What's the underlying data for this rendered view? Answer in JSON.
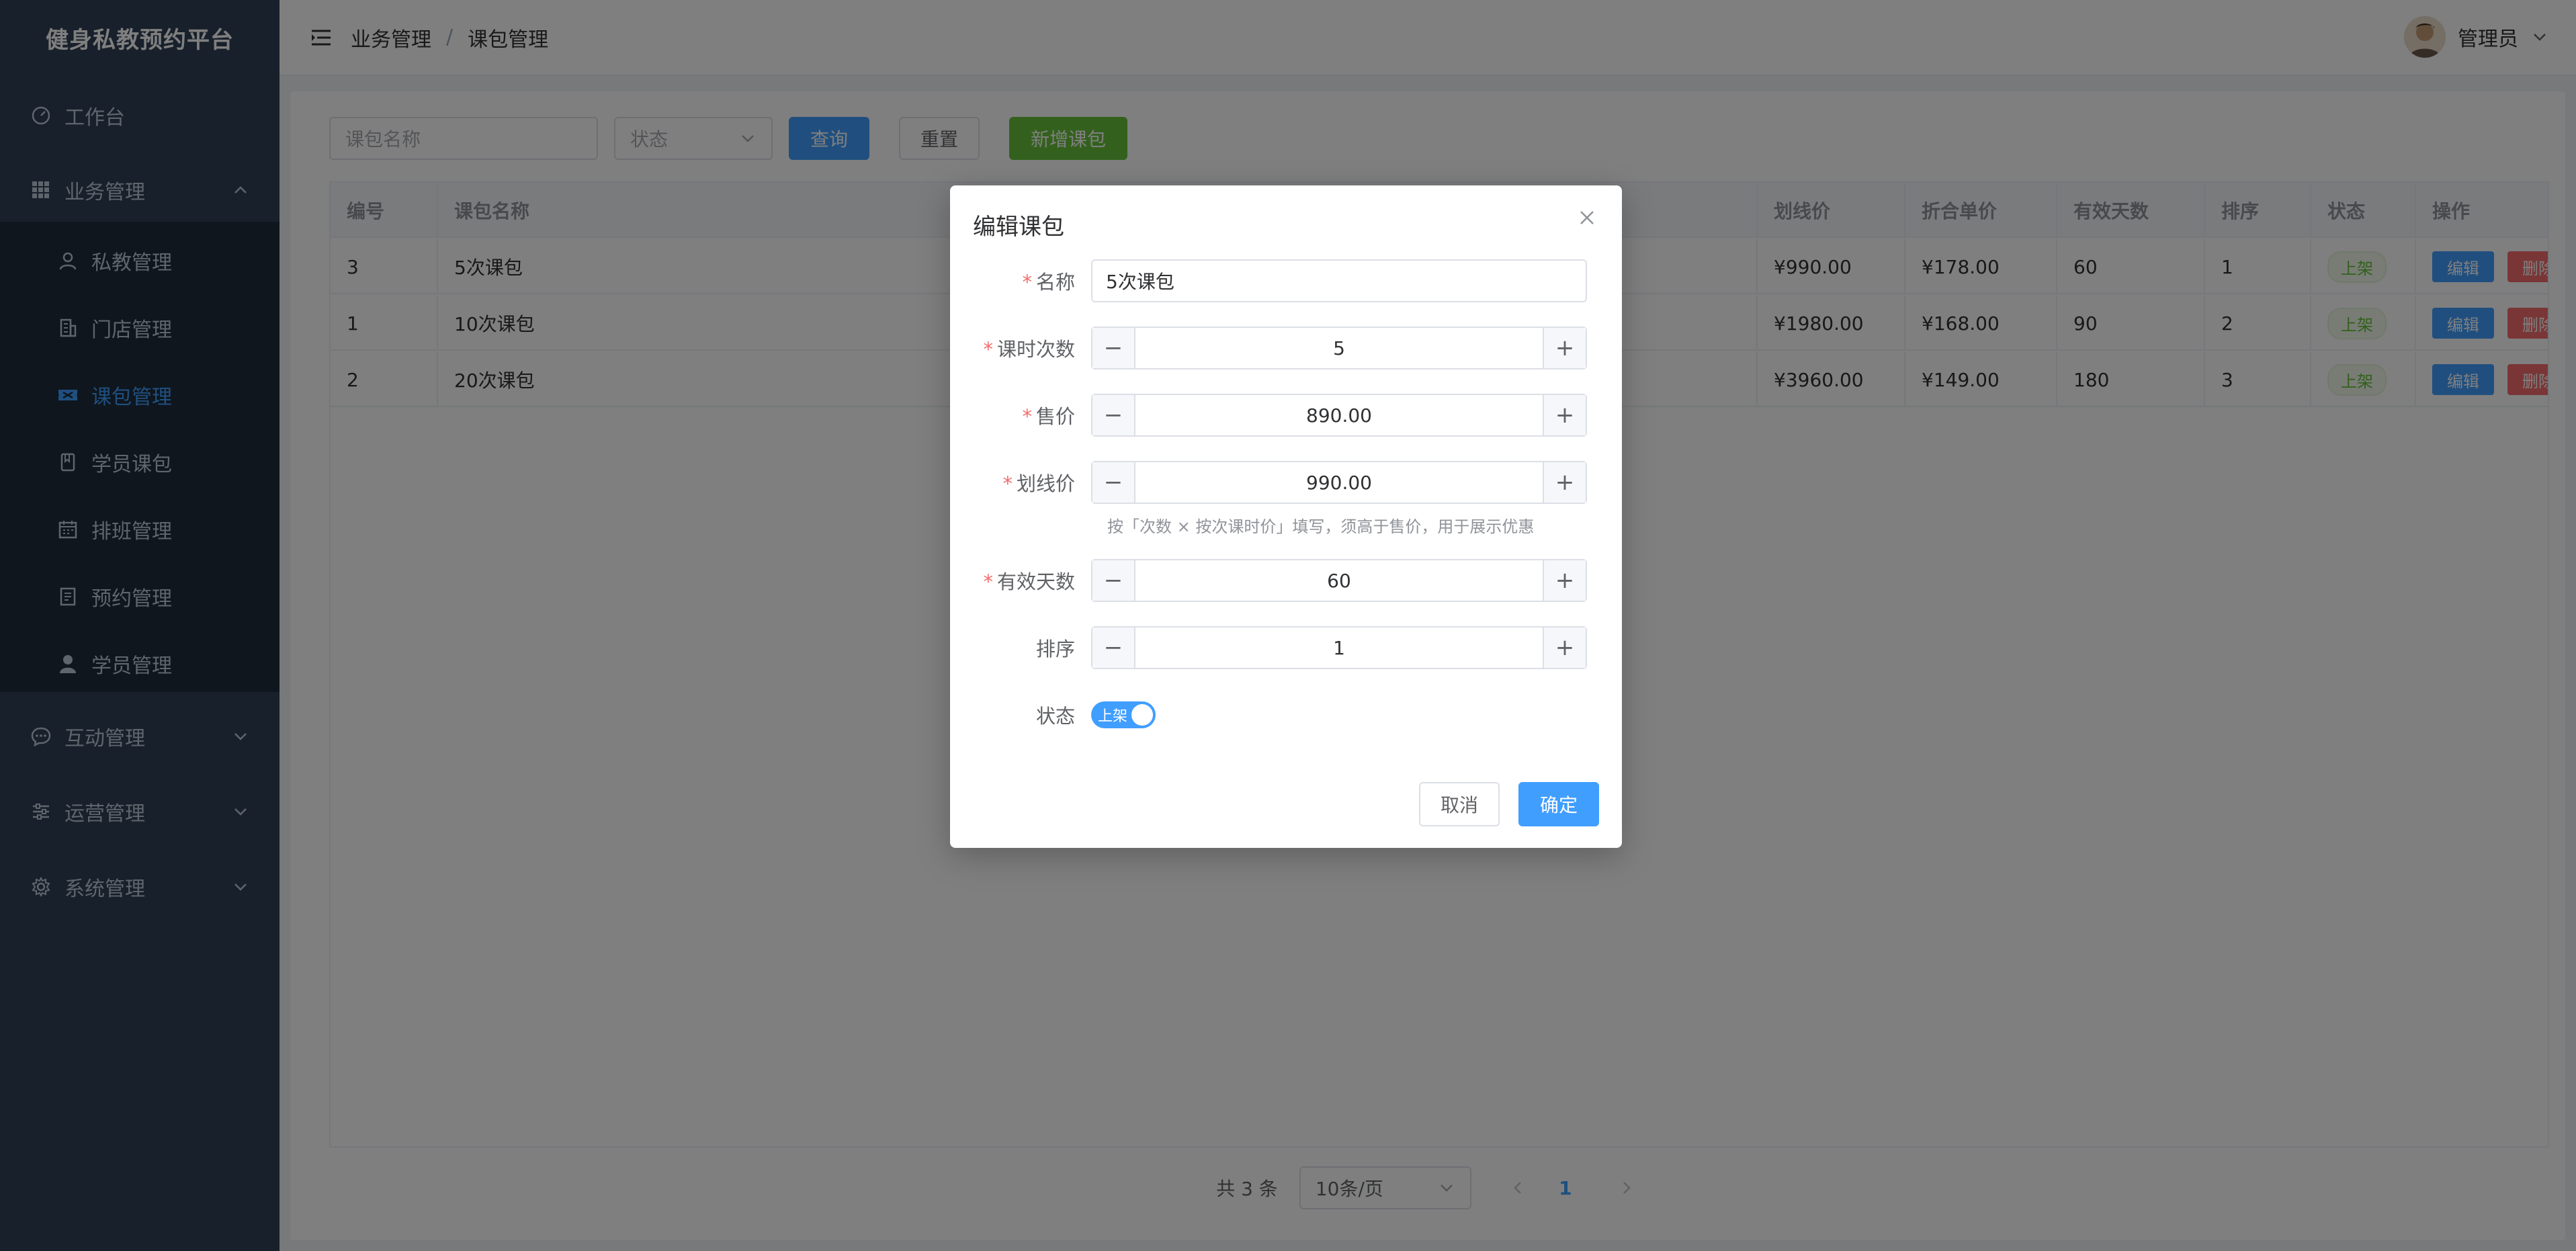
{
  "app": {
    "title": "健身私教预约平台"
  },
  "sidebar": {
    "items": [
      {
        "label": "工作台",
        "icon": "dashboard-icon"
      },
      {
        "label": "业务管理",
        "icon": "grid-icon",
        "expanded": true
      },
      {
        "label": "私教管理",
        "icon": "user-icon"
      },
      {
        "label": "门店管理",
        "icon": "building-icon"
      },
      {
        "label": "课包管理",
        "icon": "ticket-icon",
        "active": true
      },
      {
        "label": "学员课包",
        "icon": "book-icon"
      },
      {
        "label": "排班管理",
        "icon": "calendar-icon"
      },
      {
        "label": "预约管理",
        "icon": "document-icon"
      },
      {
        "label": "学员管理",
        "icon": "person-icon"
      },
      {
        "label": "互动管理",
        "icon": "chat-icon"
      },
      {
        "label": "运营管理",
        "icon": "sliders-icon"
      },
      {
        "label": "系统管理",
        "icon": "gear-icon"
      }
    ]
  },
  "header": {
    "breadcrumb": [
      "业务管理",
      "/",
      "课包管理"
    ],
    "user": "管理员"
  },
  "toolbar": {
    "name_placeholder": "课包名称",
    "status_placeholder": "状态",
    "query": "查询",
    "reset": "重置",
    "add": "新增课包"
  },
  "table": {
    "columns": [
      "编号",
      "课包名称",
      "划线价",
      "折合单价",
      "有效天数",
      "排序",
      "状态",
      "操作"
    ],
    "rows": [
      {
        "id": "3",
        "name": "5次课包",
        "list_price": "¥990.00",
        "unit_price": "¥178.00",
        "days": "60",
        "sort": "1",
        "status": "上架"
      },
      {
        "id": "1",
        "name": "10次课包",
        "list_price": "¥1980.00",
        "unit_price": "¥168.00",
        "days": "90",
        "sort": "2",
        "status": "上架"
      },
      {
        "id": "2",
        "name": "20次课包",
        "list_price": "¥3960.00",
        "unit_price": "¥149.00",
        "days": "180",
        "sort": "3",
        "status": "上架"
      }
    ],
    "edit": "编辑",
    "delete": "删除"
  },
  "pagination": {
    "total": "共 3 条",
    "page_size": "10条/页",
    "current": "1"
  },
  "dialog": {
    "title": "编辑课包",
    "fields": {
      "name": {
        "label": "名称",
        "value": "5次课包"
      },
      "sessions": {
        "label": "课时次数",
        "value": "5"
      },
      "price": {
        "label": "售价",
        "value": "890.00"
      },
      "list_price": {
        "label": "划线价",
        "value": "990.00"
      },
      "hint": "按「次数 × 按次课时价」填写，须高于售价，用于展示优惠",
      "days": {
        "label": "有效天数",
        "value": "60"
      },
      "sort": {
        "label": "排序",
        "value": "1"
      },
      "status": {
        "label": "状态",
        "value": "上架",
        "on": true
      }
    },
    "cancel": "取消",
    "confirm": "确定"
  },
  "colors": {
    "primary": "#409eff",
    "success": "#67c23a",
    "danger": "#f56c6c",
    "sidebar": "#304156"
  }
}
